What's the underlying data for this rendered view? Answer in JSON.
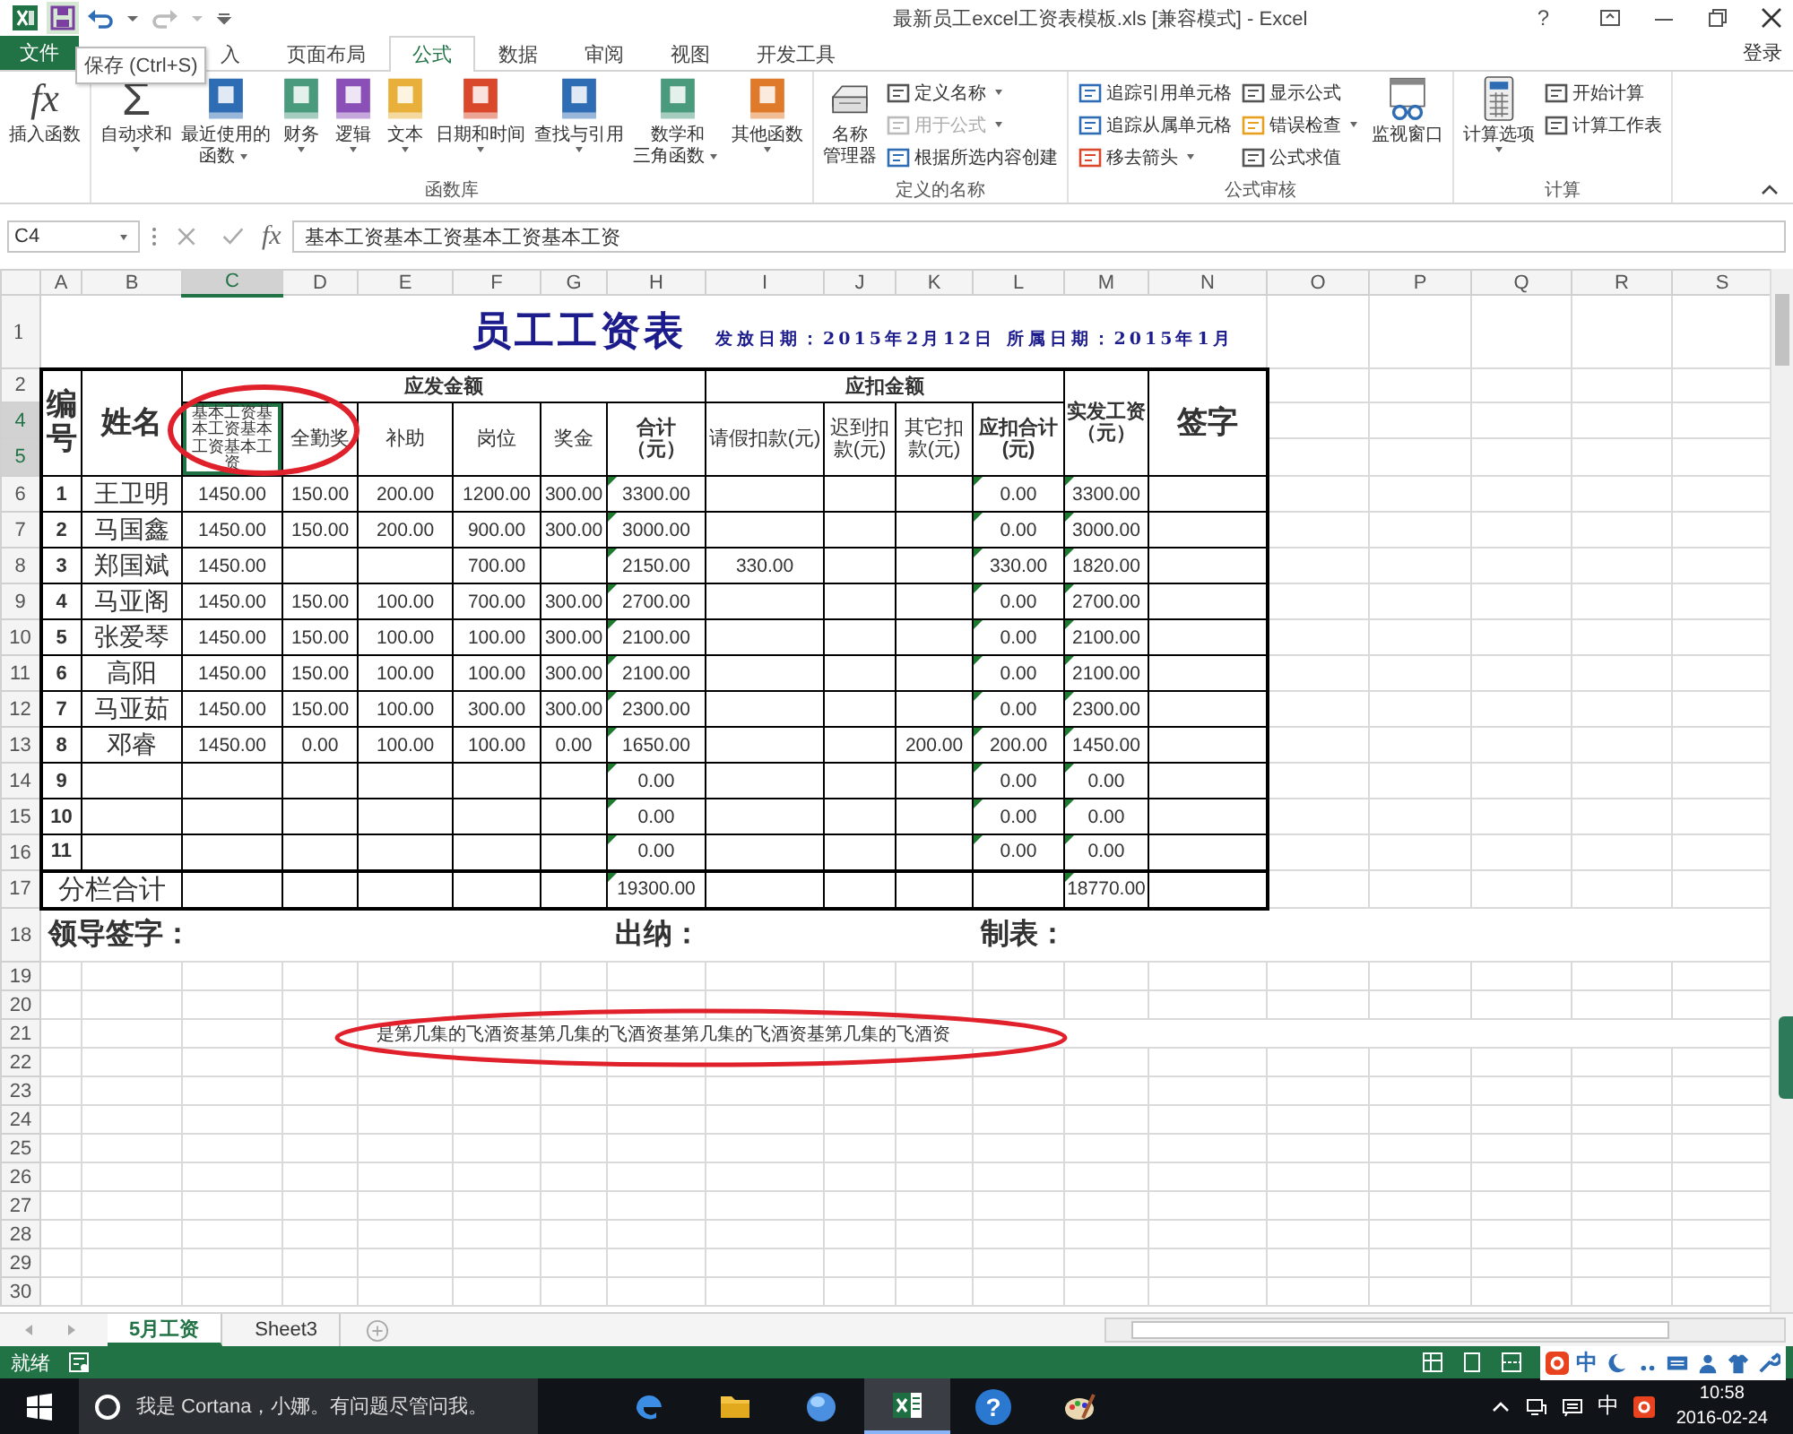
{
  "window": {
    "title": "最新员工excel工资表模板.xls  [兼容模式] - Excel",
    "help": "?",
    "sign_in": "登录"
  },
  "tooltip": "保存 (Ctrl+S)",
  "tabs": [
    {
      "label": "文件",
      "kind": "file",
      "selected": false
    },
    {
      "label": "入",
      "kind": "tab",
      "selected": false
    },
    {
      "label": "页面布局",
      "kind": "tab",
      "selected": false
    },
    {
      "label": "公式",
      "kind": "tab",
      "selected": true
    },
    {
      "label": "数据",
      "kind": "tab",
      "selected": false
    },
    {
      "label": "审阅",
      "kind": "tab",
      "selected": false
    },
    {
      "label": "视图",
      "kind": "tab",
      "selected": false
    },
    {
      "label": "开发工具",
      "kind": "tab",
      "selected": false
    }
  ],
  "ribbon": {
    "groups": [
      {
        "items": [
          {
            "kind": "large",
            "glyph": "fx",
            "lines": [
              "插入函数"
            ],
            "dropdown": false
          }
        ]
      },
      {
        "label": "函数库",
        "items": [
          {
            "kind": "large",
            "glyph": "Σ",
            "lines": [
              "自动求和"
            ],
            "dropdown": true
          },
          {
            "kind": "large",
            "lines": [
              "最近使用的",
              "函数"
            ],
            "dropdown": true
          },
          {
            "kind": "large",
            "lines": [
              "财务"
            ],
            "dropdown": true
          },
          {
            "kind": "large",
            "lines": [
              "逻辑"
            ],
            "dropdown": true
          },
          {
            "kind": "large",
            "lines": [
              "文本"
            ],
            "dropdown": true
          },
          {
            "kind": "large",
            "lines": [
              "日期和时间"
            ],
            "dropdown": true
          },
          {
            "kind": "large",
            "lines": [
              "查找与引用"
            ],
            "dropdown": true
          },
          {
            "kind": "large",
            "lines": [
              "数学和",
              "三角函数"
            ],
            "dropdown": true
          },
          {
            "kind": "large",
            "lines": [
              "其他函数"
            ],
            "dropdown": true
          }
        ]
      },
      {
        "label": "定义的名称",
        "items": [
          {
            "kind": "large",
            "lines": [
              "名称",
              "管理器"
            ],
            "dropdown": false
          },
          {
            "kind": "stack",
            "items": [
              {
                "label": "定义名称",
                "dropdown": true,
                "disabled": false
              },
              {
                "label": "用于公式",
                "dropdown": true,
                "disabled": true
              },
              {
                "label": "根据所选内容创建",
                "dropdown": false,
                "disabled": false
              }
            ]
          }
        ]
      },
      {
        "label": "公式审核",
        "items": [
          {
            "kind": "stack",
            "items": [
              {
                "label": "追踪引用单元格",
                "dropdown": false,
                "disabled": false
              },
              {
                "label": "追踪从属单元格",
                "dropdown": false,
                "disabled": false
              },
              {
                "label": "移去箭头",
                "dropdown": true,
                "disabled": false
              }
            ]
          },
          {
            "kind": "stack",
            "items": [
              {
                "label": "显示公式",
                "dropdown": false,
                "disabled": false
              },
              {
                "label": "错误检查",
                "dropdown": true,
                "disabled": false
              },
              {
                "label": "公式求值",
                "dropdown": false,
                "disabled": false
              }
            ]
          },
          {
            "kind": "large",
            "lines": [
              "监视窗口"
            ],
            "dropdown": false
          }
        ]
      },
      {
        "label": "计算",
        "items": [
          {
            "kind": "large",
            "lines": [
              "计算选项"
            ],
            "dropdown": true
          },
          {
            "kind": "stack",
            "items": [
              {
                "label": "开始计算",
                "dropdown": false,
                "disabled": false
              },
              {
                "label": "计算工作表",
                "dropdown": false,
                "disabled": false
              }
            ]
          }
        ]
      }
    ]
  },
  "formula_bar": {
    "name_box": "C4",
    "fx": "fx",
    "value": "基本工资基本工资基本工资基本工资"
  },
  "sheet": {
    "columns": [
      {
        "label": "A",
        "selected": false
      },
      {
        "label": "B",
        "selected": false
      },
      {
        "label": "C",
        "selected": true
      },
      {
        "label": "D",
        "selected": false
      },
      {
        "label": "E",
        "selected": false
      },
      {
        "label": "F",
        "selected": false
      },
      {
        "label": "G",
        "selected": false
      },
      {
        "label": "H",
        "selected": false
      },
      {
        "label": "I",
        "selected": false
      },
      {
        "label": "J",
        "selected": false
      },
      {
        "label": "K",
        "selected": false
      },
      {
        "label": "L",
        "selected": false
      },
      {
        "label": "M",
        "selected": false
      },
      {
        "label": "N",
        "selected": false
      },
      {
        "label": "O",
        "selected": false
      },
      {
        "label": "P",
        "selected": false
      },
      {
        "label": "Q",
        "selected": false
      },
      {
        "label": "R",
        "selected": false
      },
      {
        "label": "S",
        "selected": false
      }
    ],
    "rows": [
      {
        "kind": "title",
        "label": "1",
        "selected": false,
        "title": "员工工资表",
        "issue_date": "发放日期：2015年2月12日",
        "period": "所属日期：2015年1月"
      },
      {
        "kind": "header",
        "label": "2",
        "selected": false,
        "id": "编号",
        "name": "姓名",
        "gross": "应发金额",
        "deduct": "应扣金额",
        "net": "实发工资（元）",
        "sign": "签字"
      },
      {
        "kind": "subheader",
        "label": "4",
        "selected": true,
        "cells": [
          {
            "text": "基本工资基本工资基本工资基本工资",
            "kind": "item",
            "selected": true
          },
          {
            "text": "全勤奖",
            "kind": "item",
            "selected": false
          },
          {
            "text": "补助",
            "kind": "item",
            "selected": false
          },
          {
            "text": "岗位",
            "kind": "item",
            "selected": false
          },
          {
            "text": "奖金",
            "kind": "item",
            "selected": false
          },
          {
            "text": "合计（元）",
            "kind": "total",
            "selected": false
          },
          {
            "text": "请假扣款(元)",
            "kind": "item",
            "selected": false
          },
          {
            "text": "迟到扣款(元)",
            "kind": "item",
            "selected": false
          },
          {
            "text": "其它扣款(元)",
            "kind": "item",
            "selected": false
          },
          {
            "text": "应扣合计(元)",
            "kind": "total",
            "selected": false
          }
        ]
      },
      {
        "kind": "spacer",
        "label": "5",
        "selected": true
      },
      {
        "kind": "employee",
        "label": "6",
        "selected": false,
        "id": "1",
        "name": "王卫明",
        "cells": [
          {
            "value": "1450.00",
            "flagged": false
          },
          {
            "value": "150.00",
            "flagged": false
          },
          {
            "value": "200.00",
            "flagged": false
          },
          {
            "value": "1200.00",
            "flagged": false
          },
          {
            "value": "300.00",
            "flagged": false
          },
          {
            "value": "3300.00",
            "flagged": true
          },
          null,
          null,
          null,
          {
            "value": "0.00",
            "flagged": true
          },
          {
            "value": "3300.00",
            "flagged": true
          }
        ]
      },
      {
        "kind": "employee",
        "label": "7",
        "selected": false,
        "id": "2",
        "name": "马国鑫",
        "cells": [
          {
            "value": "1450.00",
            "flagged": false
          },
          {
            "value": "150.00",
            "flagged": false
          },
          {
            "value": "200.00",
            "flagged": false
          },
          {
            "value": "900.00",
            "flagged": false
          },
          {
            "value": "300.00",
            "flagged": false
          },
          {
            "value": "3000.00",
            "flagged": true
          },
          null,
          null,
          null,
          {
            "value": "0.00",
            "flagged": true
          },
          {
            "value": "3000.00",
            "flagged": true
          }
        ]
      },
      {
        "kind": "employee",
        "label": "8",
        "selected": false,
        "id": "3",
        "name": "郑国斌",
        "cells": [
          {
            "value": "1450.00",
            "flagged": false
          },
          null,
          null,
          {
            "value": "700.00",
            "flagged": false
          },
          null,
          {
            "value": "2150.00",
            "flagged": true
          },
          {
            "value": "330.00",
            "flagged": false
          },
          null,
          null,
          {
            "value": "330.00",
            "flagged": true
          },
          {
            "value": "1820.00",
            "flagged": true
          }
        ]
      },
      {
        "kind": "employee",
        "label": "9",
        "selected": false,
        "id": "4",
        "name": "马亚阁",
        "cells": [
          {
            "value": "1450.00",
            "flagged": false
          },
          {
            "value": "150.00",
            "flagged": false
          },
          {
            "value": "100.00",
            "flagged": false
          },
          {
            "value": "700.00",
            "flagged": false
          },
          {
            "value": "300.00",
            "flagged": false
          },
          {
            "value": "2700.00",
            "flagged": true
          },
          null,
          null,
          null,
          {
            "value": "0.00",
            "flagged": true
          },
          {
            "value": "2700.00",
            "flagged": true
          }
        ]
      },
      {
        "kind": "employee",
        "label": "10",
        "selected": false,
        "id": "5",
        "name": "张爱琴",
        "cells": [
          {
            "value": "1450.00",
            "flagged": false
          },
          {
            "value": "150.00",
            "flagged": false
          },
          {
            "value": "100.00",
            "flagged": false
          },
          {
            "value": "100.00",
            "flagged": false
          },
          {
            "value": "300.00",
            "flagged": false
          },
          {
            "value": "2100.00",
            "flagged": true
          },
          null,
          null,
          null,
          {
            "value": "0.00",
            "flagged": true
          },
          {
            "value": "2100.00",
            "flagged": true
          }
        ]
      },
      {
        "kind": "employee",
        "label": "11",
        "selected": false,
        "id": "6",
        "name": "高阳",
        "cells": [
          {
            "value": "1450.00",
            "flagged": false
          },
          {
            "value": "150.00",
            "flagged": false
          },
          {
            "value": "100.00",
            "flagged": false
          },
          {
            "value": "100.00",
            "flagged": false
          },
          {
            "value": "300.00",
            "flagged": false
          },
          {
            "value": "2100.00",
            "flagged": true
          },
          null,
          null,
          null,
          {
            "value": "0.00",
            "flagged": true
          },
          {
            "value": "2100.00",
            "flagged": true
          }
        ]
      },
      {
        "kind": "employee",
        "label": "12",
        "selected": false,
        "id": "7",
        "name": "马亚茹",
        "cells": [
          {
            "value": "1450.00",
            "flagged": false
          },
          {
            "value": "150.00",
            "flagged": false
          },
          {
            "value": "100.00",
            "flagged": false
          },
          {
            "value": "300.00",
            "flagged": false
          },
          {
            "value": "300.00",
            "flagged": false
          },
          {
            "value": "2300.00",
            "flagged": true
          },
          null,
          null,
          null,
          {
            "value": "0.00",
            "flagged": true
          },
          {
            "value": "2300.00",
            "flagged": true
          }
        ]
      },
      {
        "kind": "employee",
        "label": "13",
        "selected": false,
        "id": "8",
        "name": "邓睿",
        "cells": [
          {
            "value": "1450.00",
            "flagged": false
          },
          {
            "value": "0.00",
            "flagged": false
          },
          {
            "value": "100.00",
            "flagged": false
          },
          {
            "value": "100.00",
            "flagged": false
          },
          {
            "value": "0.00",
            "flagged": false
          },
          {
            "value": "1650.00",
            "flagged": true
          },
          null,
          null,
          {
            "value": "200.00",
            "flagged": false
          },
          {
            "value": "200.00",
            "flagged": true
          },
          {
            "value": "1450.00",
            "flagged": true
          }
        ]
      },
      {
        "kind": "employee",
        "label": "14",
        "selected": false,
        "id": "9",
        "cells": [
          null,
          null,
          null,
          null,
          null,
          {
            "value": "0.00",
            "flagged": true
          },
          null,
          null,
          null,
          {
            "value": "0.00",
            "flagged": true
          },
          {
            "value": "0.00",
            "flagged": true
          }
        ]
      },
      {
        "kind": "employee",
        "label": "15",
        "selected": false,
        "id": "10",
        "cells": [
          null,
          null,
          null,
          null,
          null,
          {
            "value": "0.00",
            "flagged": true
          },
          null,
          null,
          null,
          {
            "value": "0.00",
            "flagged": true
          },
          {
            "value": "0.00",
            "flagged": true
          }
        ]
      },
      {
        "kind": "employee",
        "label": "16",
        "selected": false,
        "id": "11",
        "cells": [
          null,
          null,
          null,
          null,
          null,
          {
            "value": "0.00",
            "flagged": true
          },
          null,
          null,
          null,
          {
            "value": "0.00",
            "flagged": true
          },
          {
            "value": "0.00",
            "flagged": true
          }
        ]
      },
      {
        "kind": "total",
        "label": "17",
        "selected": false,
        "text": "分栏合计",
        "cells": [
          null,
          null,
          null,
          null,
          null,
          {
            "value": "19300.00",
            "flagged": true
          },
          null,
          null,
          null,
          null,
          {
            "value": "18770.00",
            "flagged": true
          }
        ]
      },
      {
        "kind": "signatures",
        "label": "18",
        "selected": false,
        "items": [
          "领导签字：",
          "出纳：",
          "制表："
        ]
      },
      {
        "kind": "blank",
        "label": "19",
        "selected": false
      },
      {
        "kind": "blank",
        "label": "20",
        "selected": false
      },
      {
        "kind": "note",
        "label": "21",
        "selected": false,
        "text": "是第几集的飞酒资基第几集的飞酒资基第几集的飞酒资基第几集的飞酒资"
      },
      {
        "kind": "blank",
        "label": "22",
        "selected": false
      },
      {
        "kind": "blank",
        "label": "23",
        "selected": false
      },
      {
        "kind": "blank",
        "label": "24",
        "selected": false
      },
      {
        "kind": "blank",
        "label": "25",
        "selected": false
      },
      {
        "kind": "blank",
        "label": "26",
        "selected": false
      },
      {
        "kind": "blank",
        "label": "27",
        "selected": false
      },
      {
        "kind": "blank",
        "label": "28",
        "selected": false
      },
      {
        "kind": "blank",
        "label": "29",
        "selected": false
      },
      {
        "kind": "blank",
        "label": "30",
        "selected": false
      }
    ]
  },
  "sheet_tabs": [
    {
      "label": "5月工资",
      "selected": true
    },
    {
      "label": "Sheet3",
      "selected": false
    }
  ],
  "status_bar": {
    "status": "就绪",
    "ime": "中"
  },
  "taskbar": {
    "search_placeholder": "我是 Cortana，小娜。有问题尽管问我。",
    "apps": [
      {
        "kind": "edge",
        "selected": false
      },
      {
        "kind": "folder",
        "selected": false
      },
      {
        "kind": "globe",
        "selected": false
      },
      {
        "kind": "excel",
        "selected": true
      },
      {
        "kind": "help",
        "glyph": "?",
        "selected": false
      },
      {
        "kind": "paint",
        "selected": false
      }
    ],
    "ime": "中",
    "time": "10:58",
    "date": "2016-02-24"
  }
}
